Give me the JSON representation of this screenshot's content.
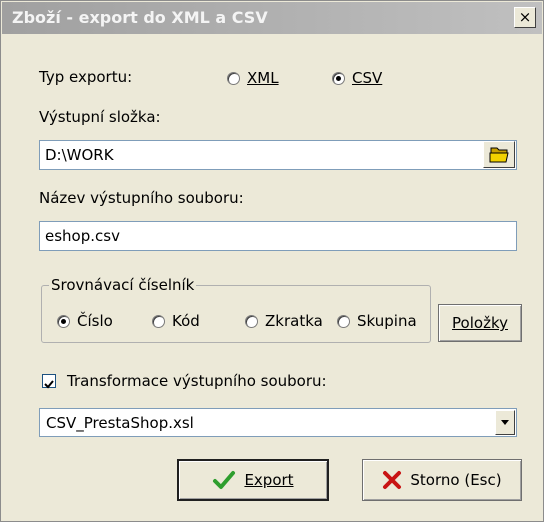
{
  "window": {
    "title": "Zboží - export do XML a CSV",
    "close_glyph": "×"
  },
  "export_type": {
    "label": "Typ exportu:",
    "options": [
      {
        "label": "XML",
        "selected": false
      },
      {
        "label": "CSV",
        "selected": true
      }
    ]
  },
  "output_folder": {
    "label": "Výstupní složka:",
    "value": "D:\\WORK",
    "browse_icon": "folder-open-icon"
  },
  "output_file": {
    "label": "Název výstupního souboru:",
    "value": "eshop.csv"
  },
  "comparison": {
    "title": "Srovnávací číselník",
    "options": [
      {
        "label": "Číslo",
        "selected": true
      },
      {
        "label": "Kód",
        "selected": false
      },
      {
        "label": "Zkratka",
        "selected": false
      },
      {
        "label": "Skupina",
        "selected": false
      }
    ],
    "items_button": "Položky"
  },
  "transform": {
    "label": "Transformace výstupního souboru:",
    "checked": true,
    "value": "CSV_PrestaShop.xsl"
  },
  "buttons": {
    "export": {
      "label": "Export",
      "icon": "checkmark-icon",
      "color": "#2e9e2e"
    },
    "cancel": {
      "label": "Storno (Esc)",
      "icon": "cross-icon",
      "color": "#c81414"
    }
  }
}
